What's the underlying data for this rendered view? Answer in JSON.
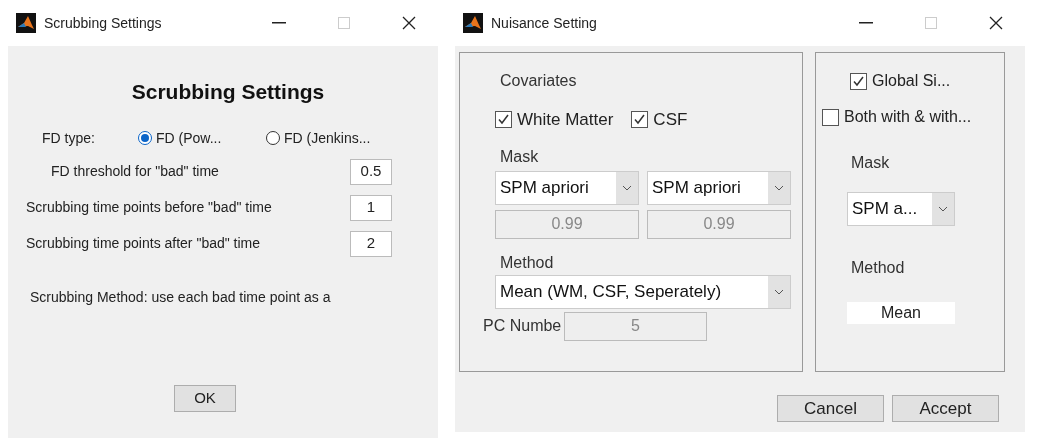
{
  "scrubbing_window": {
    "title": "Scrubbing Settings",
    "heading": "Scrubbing Settings",
    "fd_type": {
      "label": "FD type:",
      "options": [
        {
          "label": "FD (Pow...",
          "selected": true
        },
        {
          "label": "FD (Jenkins...",
          "selected": false
        }
      ]
    },
    "fields": [
      {
        "label": "FD threshold for \"bad\" time",
        "value": "0.5"
      },
      {
        "label": "Scrubbing time points before \"bad\" time",
        "value": "1"
      },
      {
        "label": "Scrubbing time points after \"bad\" time",
        "value": "2"
      }
    ],
    "method_text": "Scrubbing Method: use each bad time point as a",
    "buttons": [
      "OK"
    ]
  },
  "nuisance_window": {
    "title": "Nuisance Setting",
    "covariates": {
      "title": "Covariates",
      "checkboxes": [
        {
          "label": "White Matter",
          "checked": true
        },
        {
          "label": "CSF",
          "checked": true
        }
      ],
      "mask_label": "Mask",
      "masks": [
        {
          "value": "SPM apriori",
          "threshold": "0.99",
          "threshold_disabled": true
        },
        {
          "value": "SPM apriori",
          "threshold": "0.99",
          "threshold_disabled": true
        }
      ],
      "method_label": "Method",
      "method_value": "Mean (WM, CSF, Seperately)",
      "pc_label": "PC Numbe",
      "pc_value": "5",
      "pc_disabled": true
    },
    "global": {
      "checkboxes": [
        {
          "label": "Global Si...",
          "checked": true
        },
        {
          "label": "Both with & with...",
          "checked": false
        }
      ],
      "mask_label": "Mask",
      "mask_value": "SPM a...",
      "method_label": "Method",
      "method_value": "Mean"
    },
    "buttons": [
      "Cancel",
      "Accept"
    ]
  }
}
